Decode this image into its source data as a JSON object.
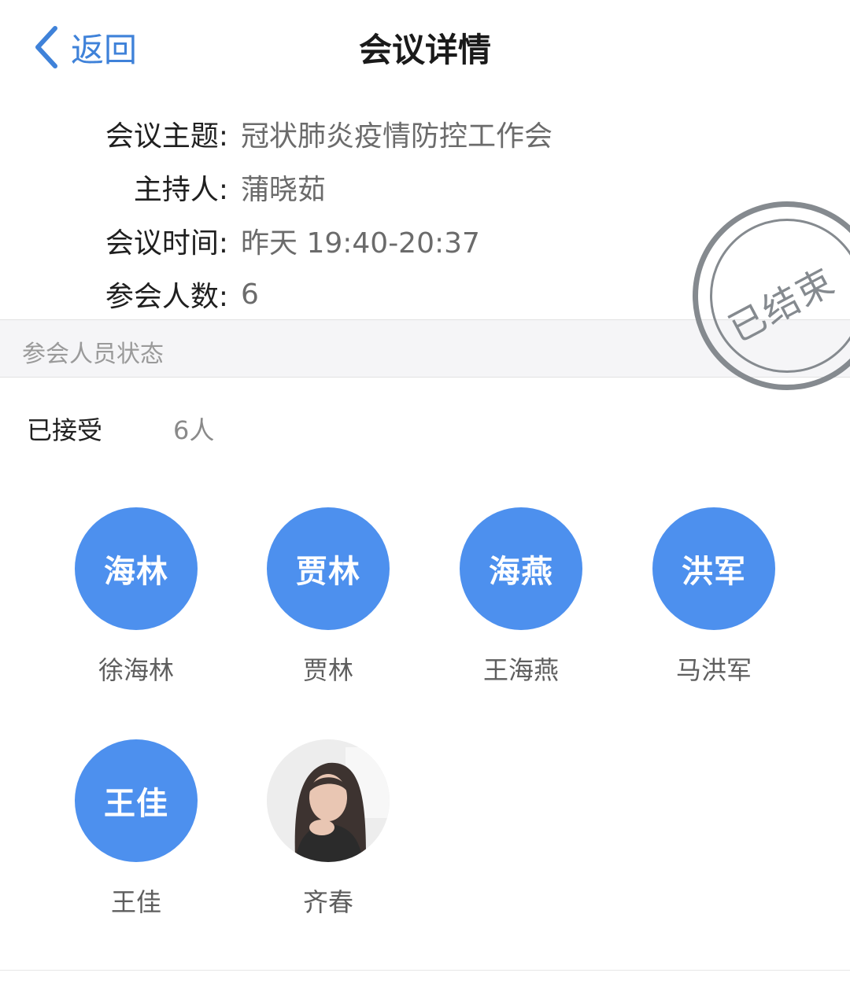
{
  "nav": {
    "back_label": "返回",
    "title": "会议详情"
  },
  "meeting": {
    "topic": {
      "label": "会议主题:",
      "value": "冠状肺炎疫情防控工作会"
    },
    "host": {
      "label": "主持人:",
      "value": "蒲晓茹"
    },
    "time": {
      "label": "会议时间:",
      "value": "昨天 19:40-20:37"
    },
    "count": {
      "label": "参会人数:",
      "value": "6"
    }
  },
  "status_stamp": "已结束",
  "section_title": "参会人员状态",
  "accepted": {
    "label": "已接受",
    "count": "6人"
  },
  "participants": [
    {
      "avatar_text": "海林",
      "name": "徐海林"
    },
    {
      "avatar_text": "贾林",
      "name": "贾林"
    },
    {
      "avatar_text": "海燕",
      "name": "王海燕"
    },
    {
      "avatar_text": "洪军",
      "name": "马洪军"
    },
    {
      "avatar_text": "王佳",
      "name": "王佳"
    },
    {
      "avatar_text": "",
      "name": "齐春",
      "avatar_type": "photo"
    }
  ],
  "colors": {
    "accent": "#3f82d9",
    "avatar_bg": "#4d90ee",
    "stamp": "#858a8f"
  }
}
